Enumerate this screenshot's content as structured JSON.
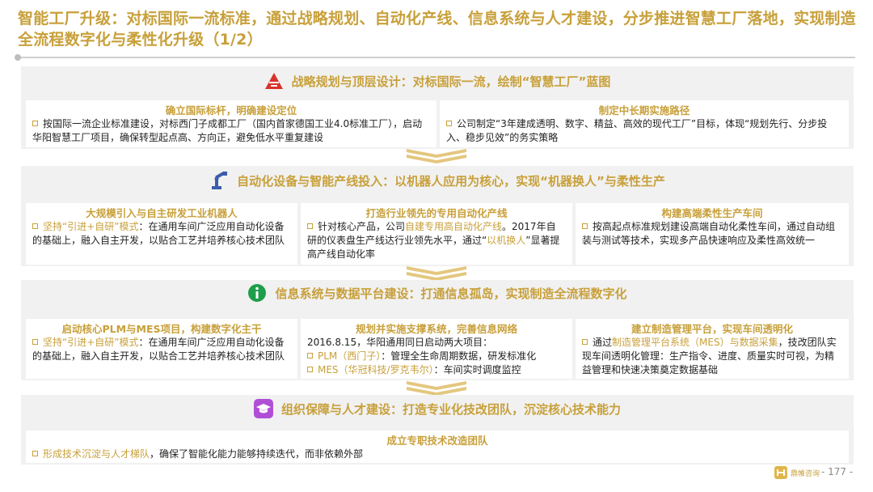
{
  "header": {
    "title": "智能工厂升级：对标国际一流标准，通过战略规划、自动化产线、信息系统与人才建设，分步推进智慧工厂落地，实现制造全流程数字化与柔性化升级（1/2）"
  },
  "sections": [
    {
      "icon": "warning-triangle-icon",
      "heading": "战略规划与顶层设计：对标国际一流，绘制“智慧工厂”蓝图",
      "cards": [
        {
          "title": "确立国际标杆，明确建设定位",
          "text": "按国际一流企业标准建设，对标西门子成都工厂（国内首家德国工业4.0标准工厂），启动华阳智慧工厂项目，确保转型起点高、方向正，避免低水平重复建设"
        },
        {
          "title": "制定中长期实施路径",
          "text": "公司制定“3年建成透明、数字、精益、高效的现代工厂”目标，体现“规划先行、分步投入、稳步见效”的务实策略"
        }
      ]
    },
    {
      "icon": "robot-arm-icon",
      "heading": "自动化设备与智能产线投入：以机器人应用为核心，实现“机器换人”与柔性生产",
      "cards": [
        {
          "title": "大规模引入与自主研发工业机器人",
          "highlight": "坚持“引进+自研”模式",
          "text": "：在通用车间广泛应用自动化设备的基础上，融入自主开发，以贴合工艺并培养核心技术团队"
        },
        {
          "title": "打造行业领先的专用自动化产线",
          "text_a": "针对核心产品，公司",
          "highlight": "自建专用高自动化产线",
          "text_b": "。2017年自研的仪表盘生产线达行业领先水平，通过“",
          "highlight2": "以机换人",
          "text_c": "”显著提高产线自动化率"
        },
        {
          "title": "构建高端柔性生产车间",
          "text": "按高起点标准规划建设高端自动化柔性车间，通过自动组装与测试等技术，实现多产品快速响应及柔性高效统一"
        }
      ]
    },
    {
      "icon": "info-circle-icon",
      "heading": "信息系统与数据平台建设：打通信息孤岛，实现制造全流程数字化",
      "cards": [
        {
          "title": "启动核心PLM与MES项目，构建数字化主干",
          "highlight": "坚持“引进+自研”模式",
          "text": "：在通用车间广泛应用自动化设备的基础上，融入自主开发，以贴合工艺并培养核心技术团队"
        },
        {
          "title": "规划并实施支撑系统，完善信息网络",
          "intro": "2016.8.15，华阳通用同日启动两大项目：",
          "items": [
            {
              "label": "PLM（西门子）",
              "text": "：管理全生命周期数据，研发标准化"
            },
            {
              "label": "MES（华冠科技/罗克韦尔）",
              "text": "：车间实时调度监控"
            }
          ]
        },
        {
          "title": "建立制造管理平台，实现车间透明化",
          "text_a": "通过",
          "highlight": "制造管理平台系统（MES）与数据采集",
          "text_b": "，技改团队实现车间透明化管理：生产指令、进度、质量实时可视，为精益管理和快速决策奠定数据基础"
        }
      ]
    },
    {
      "icon": "graduation-cap-icon",
      "heading": "组织保障与人才建设：打造专业化技改团队，沉淀核心技术能力",
      "cards": [
        {
          "title": "成立专职技术改造团队",
          "highlight": "形成技术沉淀与人才梯队",
          "text": "，确保了智能化能力能够持续迭代，而非依赖外部"
        }
      ]
    }
  ],
  "footer": {
    "logo_text": "鼎帷咨询",
    "page": "- 177 -"
  },
  "colors": {
    "accent": "#c8a03a",
    "panel": "#f1f1f1",
    "red": "#d9322b",
    "green": "#1e9e4a",
    "purple": "#b04fd6",
    "blue": "#3b5cab"
  }
}
